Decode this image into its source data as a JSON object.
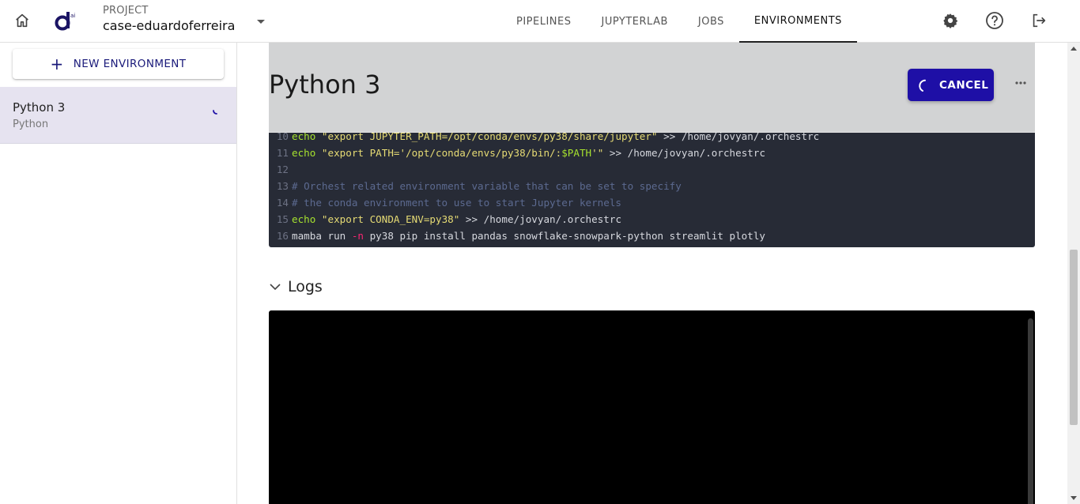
{
  "header": {
    "project_label": "PROJECT",
    "project_name": "case-eduardoferreira",
    "nav": [
      "PIPELINES",
      "JUPYTERLAB",
      "JOBS",
      "ENVIRONMENTS"
    ],
    "active_nav": "ENVIRONMENTS"
  },
  "sidebar": {
    "new_button": "NEW ENVIRONMENT",
    "environments": [
      {
        "name": "Python 3",
        "language": "Python",
        "status": "building"
      }
    ]
  },
  "main": {
    "title": "Python 3",
    "cancel_label": "CANCEL",
    "code_lines": [
      {
        "num": "10",
        "tokens": [
          {
            "t": "echo ",
            "c": "kw"
          },
          {
            "t": "\"export JUPYTER_PATH=/opt/conda/envs/py38/share/jupyter\"",
            "c": "str"
          },
          {
            "t": " >> /home/jovyan/.orchestrc",
            "c": "txt"
          }
        ]
      },
      {
        "num": "11",
        "tokens": [
          {
            "t": "echo ",
            "c": "kw"
          },
          {
            "t": "\"export PATH='/opt/conda/envs/py38/bin/:",
            "c": "str"
          },
          {
            "t": "$PATH",
            "c": "var"
          },
          {
            "t": "'\"",
            "c": "str"
          },
          {
            "t": " >> /home/jovyan/.orchestrc",
            "c": "txt"
          }
        ]
      },
      {
        "num": "12",
        "tokens": []
      },
      {
        "num": "13",
        "tokens": [
          {
            "t": "# Orchest related environment variable that can be set to specify",
            "c": "cmt"
          }
        ]
      },
      {
        "num": "14",
        "tokens": [
          {
            "t": "# the conda environment to use to start Jupyter kernels",
            "c": "cmt"
          }
        ]
      },
      {
        "num": "15",
        "tokens": [
          {
            "t": "echo ",
            "c": "kw"
          },
          {
            "t": "\"export CONDA_ENV=py38\"",
            "c": "str"
          },
          {
            "t": " >> /home/jovyan/.orchestrc",
            "c": "txt"
          }
        ]
      },
      {
        "num": "16",
        "tokens": [
          {
            "t": "mamba run ",
            "c": "txt"
          },
          {
            "t": "-n",
            "c": "flag"
          },
          {
            "t": " py38 pip install pandas snowflake-snowpark-python streamlit plotly",
            "c": "txt"
          }
        ]
      }
    ],
    "logs_title": "Logs"
  },
  "colors": {
    "accent": "#1e0fa6",
    "selected_env_bg": "#e6e3f0",
    "code_bg": "#272b36",
    "logs_bg": "#000000"
  },
  "icons": [
    "home-icon",
    "orchest-logo",
    "caret-down-icon",
    "settings-icon",
    "help-icon",
    "logout-icon",
    "plus-icon",
    "spinner-icon",
    "more-icon",
    "chevron-down-icon"
  ]
}
